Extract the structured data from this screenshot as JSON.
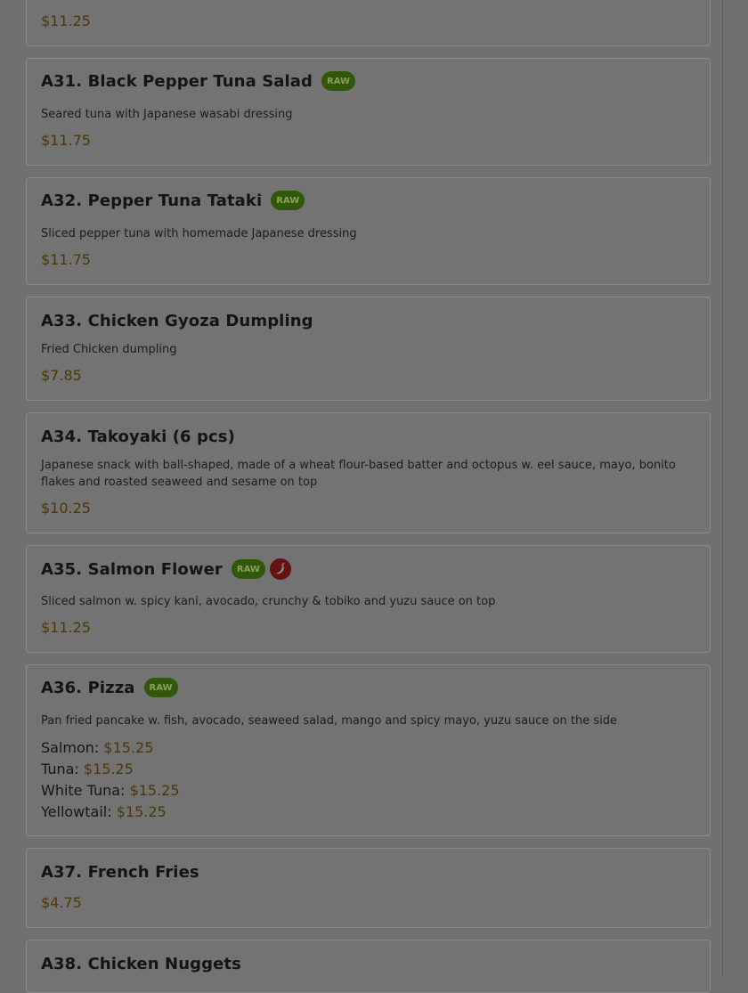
{
  "items": [
    {
      "price": "$11.25"
    },
    {
      "title": "A31. Black Pepper Tuna Salad",
      "badge": "RAW",
      "description": "Seared tuna with Japanese wasabi dressing",
      "price": "$11.75"
    },
    {
      "title": "A32. Pepper Tuna Tataki",
      "badge": "RAW",
      "description": "Sliced pepper tuna with homemade Japanese dressing",
      "price": "$11.75"
    },
    {
      "title": "A33. Chicken Gyoza Dumpling",
      "description": "Fried Chicken dumpling",
      "price": "$7.85"
    },
    {
      "title": "A34. Takoyaki (6 pcs)",
      "description": "Japanese snack with ball-shaped, made of a wheat flour-based batter and octopus w. eel sauce, mayo, bonito flakes and roasted seaweed and sesame on top",
      "price": "$10.25"
    },
    {
      "title": "A35. Salmon Flower",
      "badge": "RAW",
      "spicy_icon": "chili-pepper-icon",
      "description": "Sliced salmon w. spicy kani, avocado, crunchy & tobiko and yuzu sauce on top",
      "price": "$11.25"
    },
    {
      "title": "A36. Pizza",
      "badge": "RAW",
      "description": "Pan fried pancake w. fish, avocado, seaweed salad, mango and spicy mayo, yuzu sauce on the side",
      "options": [
        {
          "label": "Salmon:",
          "price": "$15.25"
        },
        {
          "label": "Tuna:",
          "price": "$15.25"
        },
        {
          "label": "White Tuna:",
          "price": "$15.25"
        },
        {
          "label": "Yellowtail:",
          "price": "$15.25"
        }
      ]
    },
    {
      "title": "A37. French Fries",
      "price": "$4.75"
    },
    {
      "title": "A38. Chicken Nuggets"
    }
  ]
}
